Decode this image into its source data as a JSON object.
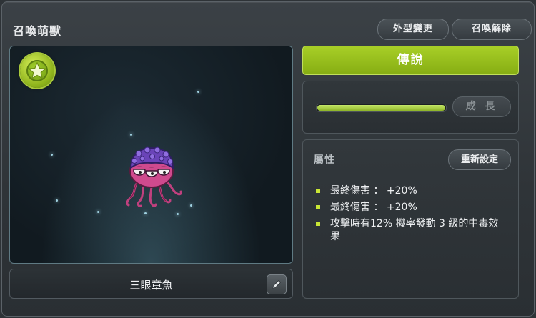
{
  "window": {
    "title": "召喚萌獸",
    "appearance_button": "外型變更",
    "release_button": "召喚解除"
  },
  "pet": {
    "name": "三眼章魚",
    "grade_icon": "star-badge-icon",
    "creature_icon": "three-eyed-octopus-sprite",
    "edit_icon": "pencil-icon"
  },
  "rank": {
    "label": "傳說",
    "color": "#9bc31f"
  },
  "growth": {
    "button_label": "成 長",
    "progress": 1.0
  },
  "attributes": {
    "title": "屬性",
    "reset_button": "重新設定",
    "items": [
      "最終傷害 ： +20%",
      "最終傷害 ： +20%",
      "攻擊時有12% 機率發動 3 級的中毒效果"
    ]
  }
}
